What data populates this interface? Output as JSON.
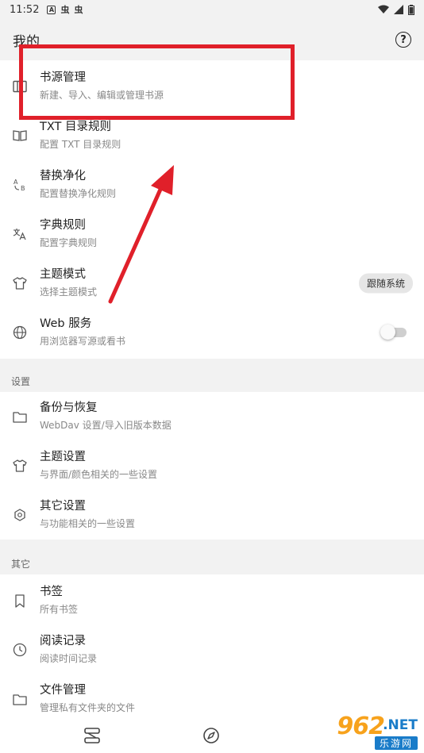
{
  "status_bar": {
    "time": "11:52",
    "notif_icons": [
      "A",
      "虫",
      "虫"
    ]
  },
  "top_bar": {
    "title": "我的",
    "help_label": "?"
  },
  "main_items": [
    {
      "title": "书源管理",
      "subtitle": "新建、导入、编辑或管理书源",
      "icon": "book-source-icon"
    },
    {
      "title": "TXT 目录规则",
      "subtitle": "配置 TXT 目录规则",
      "icon": "open-book-icon"
    },
    {
      "title": "替换净化",
      "subtitle": "配置替换净化规则",
      "icon": "replace-icon"
    },
    {
      "title": "字典规则",
      "subtitle": "配置字典规则",
      "icon": "translate-icon"
    },
    {
      "title": "主题模式",
      "subtitle": "选择主题模式",
      "icon": "shirt-icon",
      "chip": "跟随系统"
    },
    {
      "title": "Web 服务",
      "subtitle": "用浏览器写源或看书",
      "icon": "globe-icon",
      "switch_on": false
    }
  ],
  "settings_section": {
    "label": "设置",
    "items": [
      {
        "title": "备份与恢复",
        "subtitle": "WebDav 设置/导入旧版本数据",
        "icon": "folder-icon"
      },
      {
        "title": "主题设置",
        "subtitle": "与界面/颜色相关的一些设置",
        "icon": "shirt-icon"
      },
      {
        "title": "其它设置",
        "subtitle": "与功能相关的一些设置",
        "icon": "gear-icon"
      }
    ]
  },
  "other_section": {
    "label": "其它",
    "items": [
      {
        "title": "书签",
        "subtitle": "所有书签",
        "icon": "bookmark-icon"
      },
      {
        "title": "阅读记录",
        "subtitle": "阅读时间记录",
        "icon": "clock-icon"
      },
      {
        "title": "文件管理",
        "subtitle": "管理私有文件夹的文件",
        "icon": "folder-icon"
      }
    ]
  },
  "watermark": {
    "number": "962",
    "suffix": ".NET",
    "chinese": "乐游网"
  },
  "colors": {
    "highlight": "#e0202a",
    "watermark_orange": "#f7a21c",
    "watermark_blue": "#1a7cc9"
  }
}
